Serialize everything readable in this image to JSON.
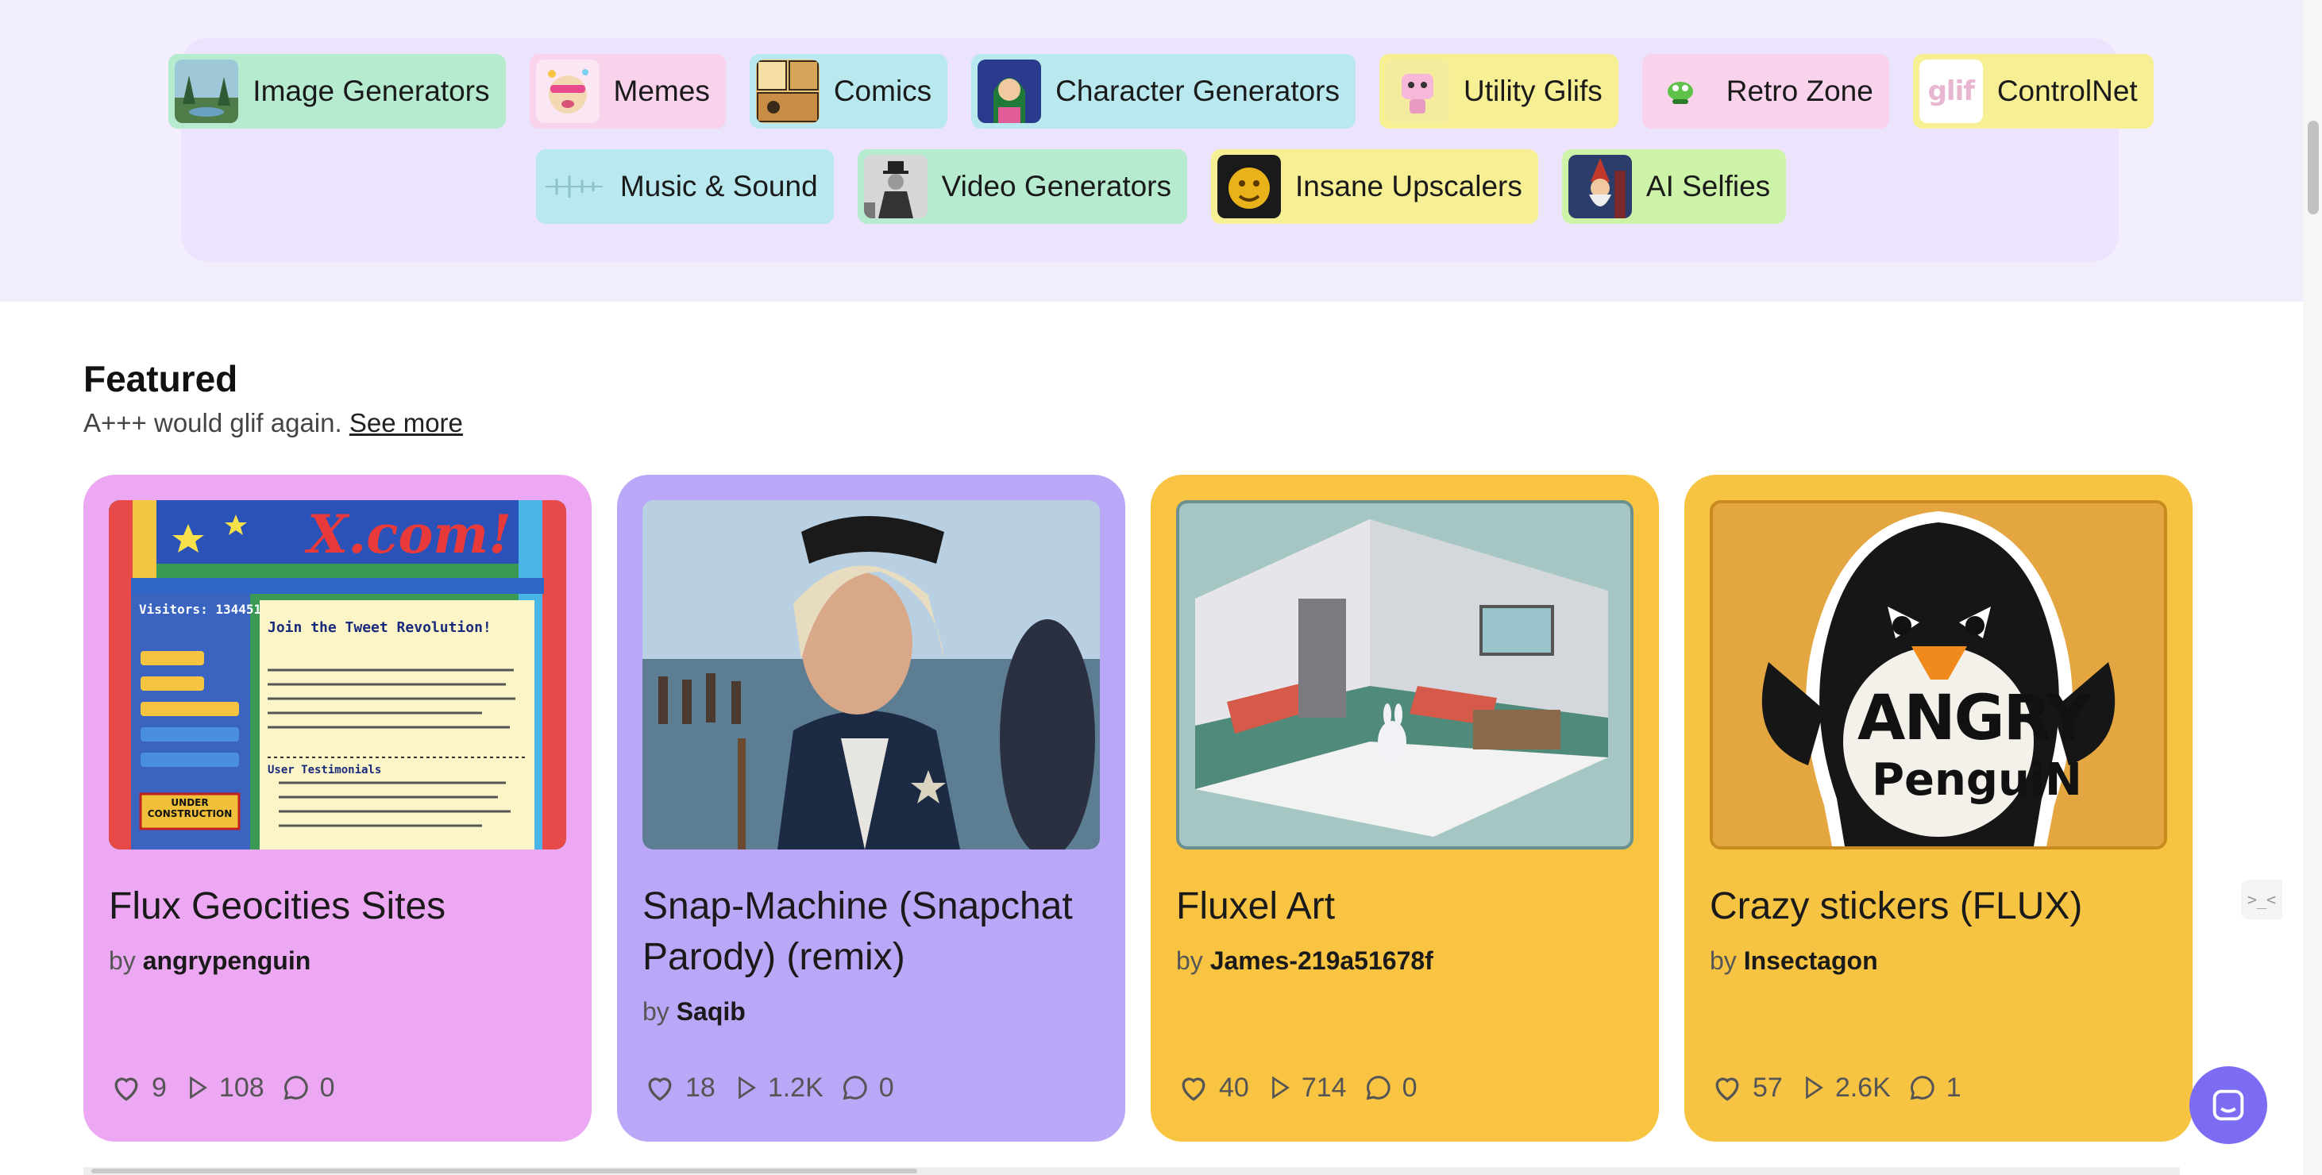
{
  "categories": {
    "row1": [
      {
        "label": "Image Generators",
        "color": "green"
      },
      {
        "label": "Memes",
        "color": "pink"
      },
      {
        "label": "Comics",
        "color": "cyan"
      },
      {
        "label": "Character Generators",
        "color": "cyan"
      },
      {
        "label": "Utility Glifs",
        "color": "yellow"
      },
      {
        "label": "Retro Zone",
        "color": "pink"
      },
      {
        "label": "ControlNet",
        "color": "yellow"
      }
    ],
    "row2": [
      {
        "label": "Music & Sound",
        "color": "cyan"
      },
      {
        "label": "Video Generators",
        "color": "green"
      },
      {
        "label": "Insane Upscalers",
        "color": "yellow"
      },
      {
        "label": "AI Selfies",
        "color": "lime"
      }
    ],
    "controlnet_logo_text": "glif"
  },
  "featured": {
    "title": "Featured",
    "subtitle": "A+++ would glif again.",
    "see_more": "See more",
    "by_prefix": "by",
    "cards": [
      {
        "title": "Flux Geocities Sites",
        "author": "angrypenguin",
        "likes": "9",
        "runs": "108",
        "comments": "0",
        "bg": "#eca8f2",
        "image_text": {
          "banner": "X.com!",
          "heading": "Join the Tweet Revolution!",
          "visitors": "Visitors: 134451",
          "construction": "UNDER CONSTRUCTION",
          "testimonials": "User Testimonials"
        }
      },
      {
        "title": "Snap-Machine (Snapchat Parody) (remix)",
        "author": "Saqib",
        "likes": "18",
        "runs": "1.2K",
        "comments": "0",
        "bg": "#bba7f7"
      },
      {
        "title": "Fluxel Art",
        "author": "James-219a51678f",
        "likes": "40",
        "runs": "714",
        "comments": "0",
        "bg": "#f9c442"
      },
      {
        "title": "Crazy stickers (FLUX)",
        "author": "Insectagon",
        "likes": "57",
        "runs": "2.6K",
        "comments": "1",
        "bg": "#f7c343",
        "image_text": {
          "line1": "ANGRY",
          "line2": "PenguiN"
        }
      }
    ]
  },
  "ui": {
    "side_tab_glyph": ">_<",
    "accent": "#7c6cf3"
  }
}
